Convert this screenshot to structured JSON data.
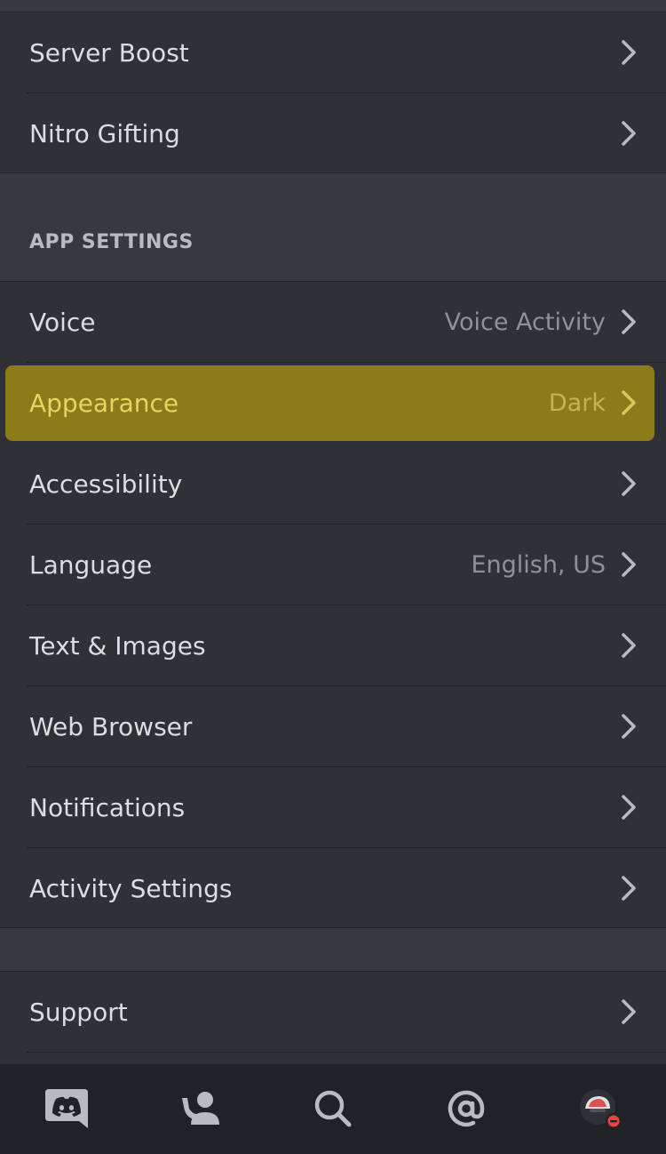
{
  "section_top": {
    "items": [
      {
        "label": "Server Boost"
      },
      {
        "label": "Nitro Gifting"
      }
    ]
  },
  "app_settings": {
    "header": "APP SETTINGS",
    "items": [
      {
        "label": "Voice",
        "value": "Voice Activity"
      },
      {
        "label": "Appearance",
        "value": "Dark"
      },
      {
        "label": "Accessibility"
      },
      {
        "label": "Language",
        "value": "English, US"
      },
      {
        "label": "Text & Images"
      },
      {
        "label": "Web Browser"
      },
      {
        "label": "Notifications"
      },
      {
        "label": "Activity Settings"
      }
    ]
  },
  "support_section": {
    "items": [
      {
        "label": "Support"
      }
    ]
  },
  "tabbar": {
    "tabs": [
      {
        "icon": "discord-home-icon"
      },
      {
        "icon": "friends-icon"
      },
      {
        "icon": "search-icon"
      },
      {
        "icon": "mentions-icon"
      },
      {
        "icon": "avatar-icon"
      }
    ]
  },
  "colors": {
    "background": "#36393f",
    "row_background": "#2f3136",
    "tabbar_background": "#202225",
    "highlight": "#8b7b1a",
    "status_dnd": "#ed4245"
  }
}
